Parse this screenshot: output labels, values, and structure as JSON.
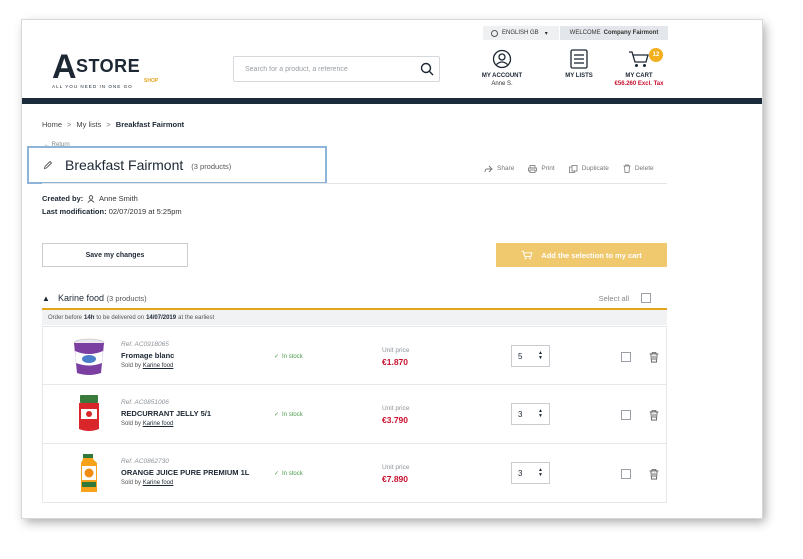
{
  "topbar": {
    "language": "ENGLISH GB",
    "welcome_prefix": "WELCOME",
    "welcome_company": "Company Fairmont"
  },
  "header": {
    "logo": {
      "letter": "A",
      "word": "STORE",
      "sub": "SHOP",
      "tagline": "ALL YOU NEED IN ONE GO"
    },
    "search": {
      "placeholder": "Search for a product, a reference"
    },
    "account": {
      "label": "MY ACCOUNT",
      "user": "Anne S."
    },
    "lists": {
      "label": "MY LISTS"
    },
    "cart": {
      "label": "MY CART",
      "badge": "12",
      "amount": "€56.260 Excl. Tax"
    }
  },
  "breadcrumb": {
    "home": "Home",
    "sep": ">",
    "lists": "My lists",
    "current": "Breakfast Fairmont"
  },
  "list": {
    "back": "Return",
    "title": "Breakfast Fairmont",
    "count": "(3 products)",
    "actions": {
      "share": "Share",
      "print": "Print",
      "duplicate": "Duplicate",
      "delete": "Delete"
    },
    "created_label": "Created by:",
    "created_value": "Anne Smith",
    "modified_label": "Last modification:",
    "modified_value": "02/07/2019 at 5:25pm",
    "save_label": "Save my changes",
    "add_label": "Add the selection to my cart"
  },
  "group": {
    "name": "Karine food",
    "count": "(3 products)",
    "select_all": "Select all",
    "delivery_prefix": "Order before",
    "delivery_hour": "14h",
    "delivery_mid": "to be delivered on",
    "delivery_date": "14/07/2019",
    "delivery_suffix": "at the earliest"
  },
  "products": [
    {
      "ref": "Ref. AC0918065",
      "name": "Fromage blanc",
      "sold_prefix": "Sold by",
      "seller": "Karine food",
      "stock": "In stock",
      "price_label": "Unit price",
      "price": "€1.870",
      "qty": "5"
    },
    {
      "ref": "Ref. AC0851006",
      "name": "REDCURRANT JELLY 5/1",
      "sold_prefix": "Sold by",
      "seller": "Karine food",
      "stock": "In stock",
      "price_label": "Unit price",
      "price": "€3.790",
      "qty": "3"
    },
    {
      "ref": "Ref. AC0862730",
      "name": "ORANGE JUICE PURE PREMIUM 1L",
      "sold_prefix": "Sold by",
      "seller": "Karine food",
      "stock": "In stock",
      "price_label": "Unit price",
      "price": "€7.890",
      "qty": "3"
    }
  ],
  "colors": {
    "brand_dark": "#1c2b3a",
    "accent": "#e3a51b",
    "price_red": "#c8102e",
    "stock_green": "#4a9a4a",
    "add_button": "#f0c86e"
  }
}
